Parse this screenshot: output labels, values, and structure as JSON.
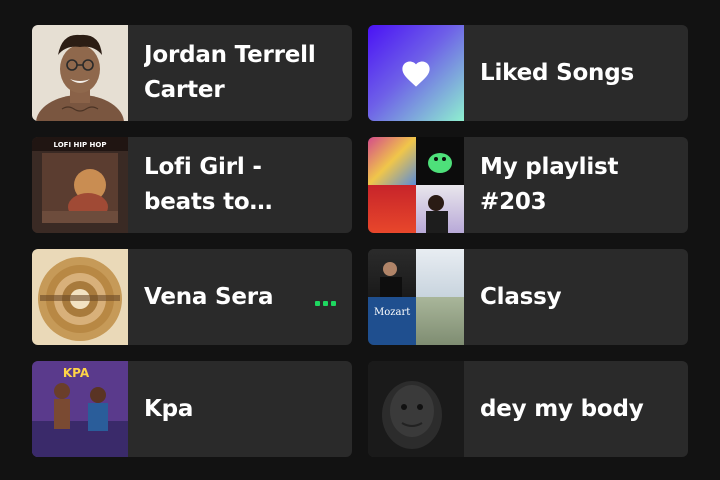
{
  "cards": [
    {
      "title": "Jordan Terrell Carter",
      "cover": "artist-portrait"
    },
    {
      "title": "Liked Songs",
      "cover": "heart-icon",
      "gradient": [
        "#4a12f5",
        "#8ef0cf"
      ]
    },
    {
      "title": "Lofi Girl - beats to relax/study to",
      "cover": "lofi-cover",
      "cover_text": "LOFI HIP HOP"
    },
    {
      "title": "My playlist #203",
      "cover": "mosaic"
    },
    {
      "title": "Vena Sera",
      "cover": "tunnel-cover",
      "now_playing": true
    },
    {
      "title": "Classy",
      "cover": "mosaic",
      "mosaic_text": "Mozart"
    },
    {
      "title": "Kpa",
      "cover": "kpa-cover",
      "cover_text": "KPA"
    },
    {
      "title": "dey my body",
      "cover": "dark-portrait"
    }
  ],
  "colors": {
    "background": "#121212",
    "card": "#2a2a2a",
    "accent": "#1ed760"
  }
}
